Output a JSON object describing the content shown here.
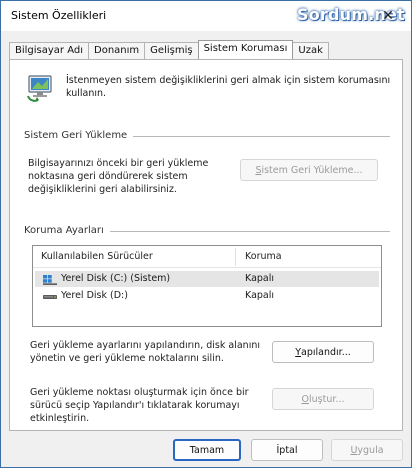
{
  "window": {
    "title": "Sistem Özellikleri",
    "watermark": "Sordum.net",
    "close_glyph": "✕"
  },
  "tabs": [
    {
      "label": "Bilgisayar Adı",
      "active": false
    },
    {
      "label": "Donanım",
      "active": false
    },
    {
      "label": "Gelişmiş",
      "active": false
    },
    {
      "label": "Sistem Koruması",
      "active": true
    },
    {
      "label": "Uzak",
      "active": false
    }
  ],
  "intro_text": "İstenmeyen sistem değişikliklerini geri almak için sistem korumasını kullanın.",
  "restore_section": {
    "title": "Sistem Geri Yükleme",
    "description": "Bilgisayarınızı önceki bir geri yükleme noktasına geri döndürerek sistem değişikliklerini geri alabilirsiniz.",
    "button_prefix": "",
    "button_mnemonic": "S",
    "button_rest": "istem Geri Yükleme...",
    "button_enabled": false
  },
  "protection_section": {
    "title": "Koruma Ayarları",
    "columns": [
      "Kullanılabilen Sürücüler",
      "Koruma"
    ],
    "drives": [
      {
        "name": "Yerel Disk (C:) (Sistem)",
        "protection": "Kapalı",
        "icon": "windows-drive-icon",
        "selected": true
      },
      {
        "name": "Yerel Disk (D:)",
        "protection": "Kapalı",
        "icon": "hard-drive-icon",
        "selected": false
      }
    ],
    "configure_description": "Geri yükleme ayarlarını yapılandırın, disk alanını yönetin ve geri yükleme noktalarını silin.",
    "configure_button": {
      "mnemonic": "Y",
      "rest": "apılandır...",
      "enabled": true
    },
    "create_description": "Geri yükleme noktası oluşturmak için önce bir sürücü seçip Yapılandır'ı tıklatarak korumayı etkinleştirin.",
    "create_button": {
      "mnemonic": "O",
      "rest": "luştur...",
      "enabled": false
    }
  },
  "footer": {
    "ok": "Tamam",
    "cancel": "İptal",
    "apply_mnemonic": "U",
    "apply_rest": "ygula",
    "apply_enabled": false
  },
  "colors": {
    "accent": "#2a66c4",
    "window_bg": "#f0f0f0",
    "panel_bg": "#ffffff"
  }
}
